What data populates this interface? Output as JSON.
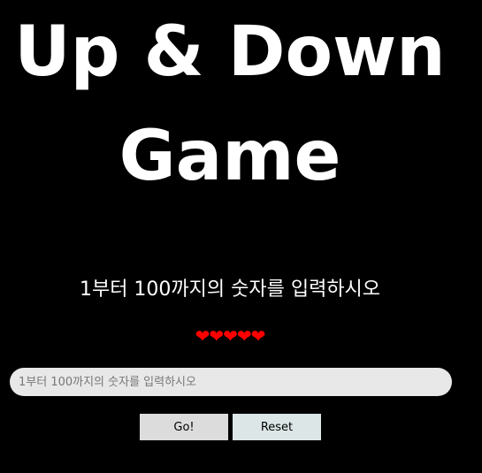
{
  "header": {
    "title_line1": "Up & Down",
    "title_line2": "Game"
  },
  "prompt": {
    "text": "1부터 100까지의 숫자를 입력하시오"
  },
  "lives": {
    "count": 5,
    "hearts": [
      "❤",
      "❤",
      "❤",
      "❤",
      "❤"
    ],
    "color": "#ff0000"
  },
  "input": {
    "value": "",
    "placeholder": "1부터 100까지의 숫자를 입력하시오"
  },
  "buttons": {
    "go_label": "Go!",
    "reset_label": "Reset"
  },
  "colors": {
    "background": "#000000",
    "text": "#ffffff",
    "input_bg": "#e8e8e8"
  }
}
